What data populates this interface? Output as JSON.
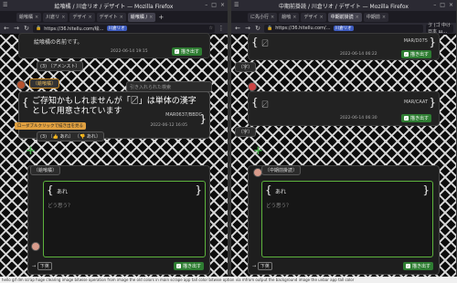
{
  "left": {
    "title": "絵喰橘 / 川倉リオ / デザイト — Mozilla Firefox",
    "tabs": [
      "絵喰橘",
      "川倉リ",
      "デザイ",
      "デザイト",
      "絵喰橘 /"
    ],
    "url": "https://36.hitellu.com/绘…",
    "url_badge": "川倉リオ",
    "post_text": "絵喰橘の名前です。",
    "post_meta": "2022-06-14 19:15",
    "reply_btn": "描き出す",
    "sub_chip": "(3) 〔アメンスト〕",
    "search_placeholder": "引き入れられた検索",
    "main_tag": "〔絵喰橘〕",
    "main_text": "ご存知かもしれませんが「〼」は単体の漢字として用意されています",
    "main_code": "MAR0637/BBDC",
    "main_meta": "2022-06-12 16:05",
    "tooltip": "ローダブルクリックで描き出を見る",
    "reactions": "(3) 〔👍 あれ〕 〔👎 あれ〕",
    "composer_tag": "〔絵喰橘〕",
    "composer_text": "あれ",
    "composer_placeholder": "どう思う？",
    "composer_submit": "描き出す",
    "composer_kbd": "下英"
  },
  "right": {
    "title": "中期前掛読 / 川倉リオ / デザイト — Mozilla Firefox",
    "tabs": [
      "に先小行",
      "絵喰",
      "デザイ",
      "中期前掛読",
      "中期前"
    ],
    "url": "https://36.hitellu.com/…",
    "url_badge": "川倉リオ",
    "search_text": "ゔ (ゴ 中け 日本 ш…",
    "card1_glyph": "〼",
    "card1_code": "MAR/D075",
    "card1_meta": "2022-06-14 06:22",
    "card1_btn": "描き出す",
    "card1_chip": "〔字〕",
    "card2_glyph": "〼",
    "card2_code": "MAR/CAAT",
    "card2_meta": "2022-06-14 06:30",
    "card2_btn": "描き出す",
    "card2_chip": "〔字〕",
    "composer_tag": "〔中期前掛読〕",
    "composer_text": "あれ",
    "composer_placeholder": "どう思う？",
    "composer_submit": "描き出す",
    "composer_kbd": "下英"
  },
  "statusbar": "hello gif dm scrap hoge clearing image bitwise operation from image the old colors in main scrape app tall color bitwise option via mfrom output the background image the unbar app tall color"
}
